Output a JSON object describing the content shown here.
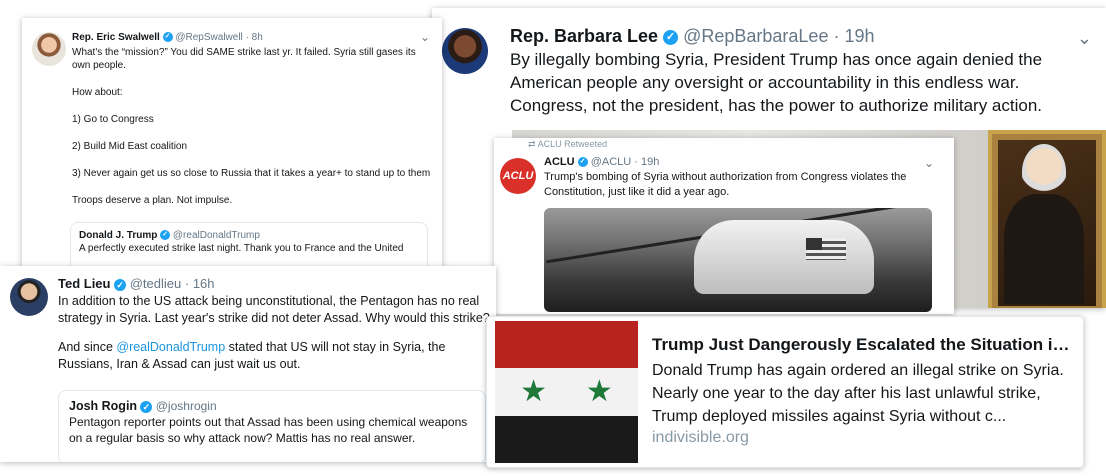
{
  "swalwell": {
    "name": "Rep. Eric Swalwell",
    "handle": "@RepSwalwell",
    "time": "· 8h",
    "lines": [
      "What's the “mission?” You did SAME strike last yr. It failed. Syria still gases its own people.",
      "How about:",
      "1) Go to Congress",
      "2) Build Mid East coalition",
      "3) Never again get us so close to Russia that it takes a year+ to stand up to them",
      "Troops deserve a plan. Not impulse."
    ],
    "quote": {
      "name": "Donald J. Trump",
      "handle": "@realDonaldTrump",
      "text": "A perfectly executed strike last night. Thank you to France and the United"
    }
  },
  "lee": {
    "name": "Rep. Barbara Lee",
    "handle": "@RepBarbaraLee",
    "time": "· 19h",
    "text": "By illegally bombing Syria, President Trump has once again denied the American people any oversight or accountability in this endless war. Congress, not the president, has the power to authorize military action."
  },
  "aclu": {
    "retweet_label": "ACLU Retweeted",
    "avatar_text": "ACLU",
    "name": "ACLU",
    "handle": "@ACLU",
    "time": "· 19h",
    "text": "Trump's bombing of Syria without authorization from Congress violates the Constitution, just like it did a year ago."
  },
  "lieu": {
    "name": "Ted Lieu",
    "handle": "@tedlieu",
    "time": "· 16h",
    "para1": "In addition to the US attack being unconstitutional, the Pentagon has no real strategy in Syria. Last year's strike did not deter Assad. Why would this strike?",
    "para2_before": "And since ",
    "para2_mention": "@realDonaldTrump",
    "para2_after": " stated that US will not stay in Syria, the Russians, Iran & Assad can just wait us out.",
    "quote": {
      "name": "Josh Rogin",
      "handle": "@joshrogin",
      "text": "Pentagon reporter points out that Assad has been using chemical weapons on a regular basis so why attack now? Mattis has no real answer."
    }
  },
  "link": {
    "title": "Trump Just Dangerously Escalated the Situation in ...",
    "description": "Donald Trump has again ordered an illegal strike on Syria. Nearly one year to the day after his last unlawful strike, Trump deployed missiles against Syria without c...",
    "domain": "indivisible.org"
  },
  "icons": {
    "verified": "✓",
    "chevron": "⌄",
    "retweet": "⇄",
    "star": "★"
  },
  "colors": {
    "verified": "#1da1f2",
    "aclu_red": "#d9302a",
    "flag_red": "#b7241f",
    "flag_white": "#f2f2f2",
    "flag_black": "#1a1a1a",
    "flag_star": "#1f7a3a",
    "link": "#1b95e0"
  }
}
